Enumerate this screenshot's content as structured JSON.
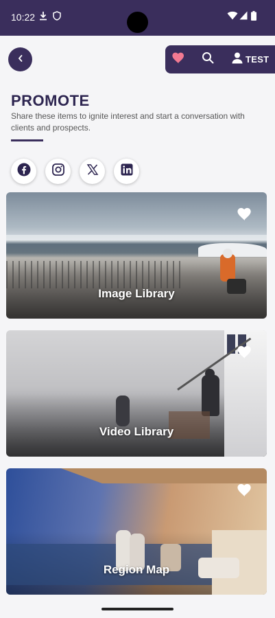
{
  "status_bar": {
    "time": "10:22"
  },
  "header": {
    "back_icon": "chevron-left-icon",
    "favorites_icon": "heart-icon",
    "search_icon": "search-icon",
    "user_icon": "person-icon",
    "user_label": "TEST"
  },
  "page": {
    "title": "PROMOTE",
    "subtitle": "Share these items to ignite interest and start a conversation with clients and prospects."
  },
  "social": [
    {
      "name": "facebook",
      "icon": "facebook-icon"
    },
    {
      "name": "instagram",
      "icon": "instagram-icon"
    },
    {
      "name": "x",
      "icon": "x-icon"
    },
    {
      "name": "linkedin",
      "icon": "linkedin-icon"
    }
  ],
  "cards": [
    {
      "label": "Image Library",
      "favorite_icon": "heart-icon"
    },
    {
      "label": "Video Library",
      "favorite_icon": "heart-icon"
    },
    {
      "label": "Region Map",
      "favorite_icon": "heart-icon"
    }
  ],
  "colors": {
    "brand": "#3a2e5c",
    "favorite_accent": "#f27a92",
    "title": "#2d2550"
  }
}
